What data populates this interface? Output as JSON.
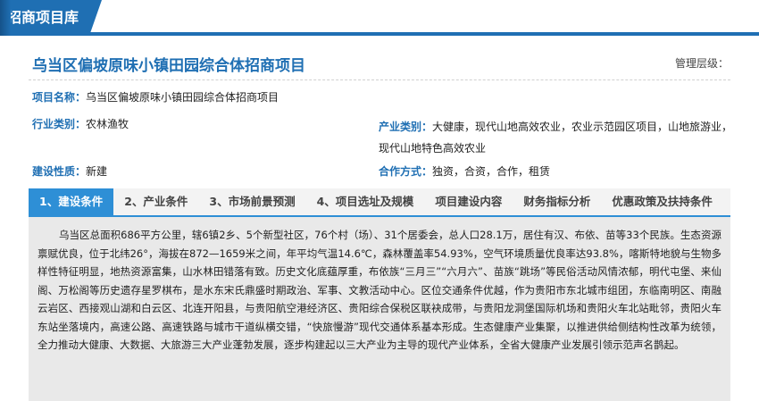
{
  "header": {
    "section_title": "招商项目库"
  },
  "project": {
    "title": "乌当区偏坡原味小镇田园综合体招商项目",
    "management_level_label": "管理层级：",
    "name_label": "项目名称：",
    "name_value": "乌当区偏坡原味小镇田园综合体招商项目",
    "industry_label": "行业类别：",
    "industry_value": "农林渔牧",
    "sector_label": "产业类别：",
    "sector_value_line1": "大健康，现代山地高效农业，农业示范园区项目，山地旅游业，",
    "sector_value_line2": "现代山地特色高效农业",
    "nature_label": "建设性质：",
    "nature_value": "新建",
    "coop_label": "合作方式：",
    "coop_value": "独资，合资，合作，租赁"
  },
  "tabs": [
    {
      "label": "1、建设条件",
      "active": true
    },
    {
      "label": "2、产业条件",
      "active": false
    },
    {
      "label": "3、市场前景预测",
      "active": false
    },
    {
      "label": "4、项目选址及规模",
      "active": false
    },
    {
      "label": "项目建设内容",
      "active": false
    },
    {
      "label": "财务指标分析",
      "active": false
    },
    {
      "label": "优惠政策及扶持条件",
      "active": false
    }
  ],
  "content": {
    "text": "乌当区总面积686平方公里，辖6镇2乡、5个新型社区，76个村（场）、31个居委会，总人口28.1万，居住有汉、布依、苗等33个民族。生态资源禀赋优良，位于北纬26°，海拔在872—1659米之间，年平均气温14.6℃，森林覆盖率54.93%，空气环境质量优良率达93.8%，喀斯特地貌与生物多样性特征明显，地热资源富集，山水林田错落有致。历史文化底蕴厚重，布依族“三月三”“六月六”、苗族“跳场”等民俗活动风情浓郁，明代屯堡、来仙阁、万松阁等历史遗存星罗棋布，是水东宋氏鼎盛时期政治、军事、文教活动中心。区位交通条件优越，作为贵阳市东北城市组团，东临南明区、南融云岩区、西接观山湖和白云区、北连开阳县，与贵阳航空港经济区、贵阳综合保税区联袂成带，与贵阳龙洞堡国际机场和贵阳火车北站毗邻，贵阳火车东站坐落境内，高速公路、高速铁路与城市干道纵横交错，“快旅慢游”现代交通体系基本形成。生态健康产业集聚，以推进供给侧结构性改革为统领，全力推动大健康、大数据、大旅游三大产业蓬勃发展，逐步构建起以三大产业为主导的现代产业体系，全省大健康产业发展引领示范声名鹊起。"
  }
}
